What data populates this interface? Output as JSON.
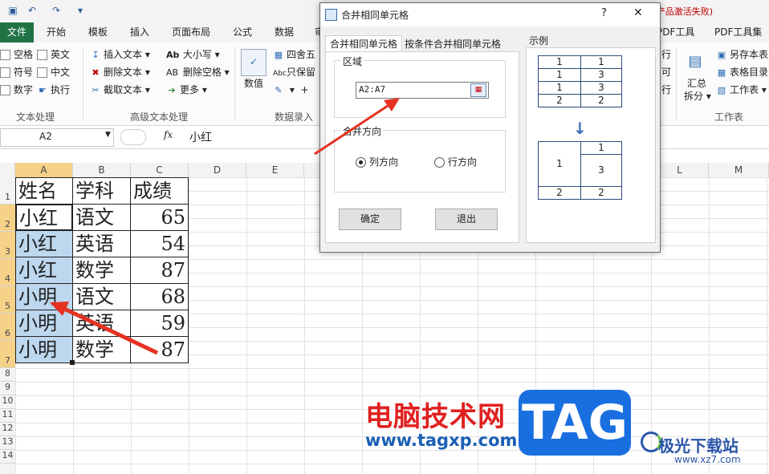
{
  "window": {
    "activation_text": "产品激活失败)"
  },
  "ribbon_tabs": [
    "文件",
    "开始",
    "模板",
    "插入",
    "页面布局",
    "公式",
    "数据",
    "审",
    "PDF工具",
    "PDF工具集"
  ],
  "ribbon": {
    "checkboxes": [
      "空格",
      "英文",
      "符号",
      "中文",
      "数字",
      "执行"
    ],
    "group1": "文本处理",
    "insert_text": "插入文本",
    "delete_text": "删除文本",
    "extract_text": "截取文本",
    "case": "大小写",
    "delete_space": "删除空格",
    "more": "更多",
    "group2": "高级文本处理",
    "number": "数值",
    "round": "四舍五",
    "keep": "只保留",
    "group3": "数据录入",
    "summary_split_1": "汇总",
    "summary_split_2": "拆分",
    "save_book": "另存本表",
    "sheet_dir": "表格目录",
    "worksheet": "工作表",
    "group4": "工作表",
    "partial_right_1": "行",
    "partial_right_2": "可",
    "partial_right_3": "行"
  },
  "formula_bar": {
    "namebox": "A2",
    "fx": "fx",
    "content": "小红"
  },
  "columns": [
    "A",
    "B",
    "C",
    "D",
    "E",
    "F",
    "G",
    "H",
    "I",
    "J",
    "K",
    "L",
    "M"
  ],
  "rows": [
    "1",
    "2",
    "3",
    "4",
    "5",
    "6",
    "7",
    "8",
    "9",
    "10",
    "11",
    "12",
    "13",
    "14"
  ],
  "table": {
    "header": [
      "姓名",
      "学科",
      "成绩"
    ],
    "rows": [
      [
        "小红",
        "语文",
        "65"
      ],
      [
        "小红",
        "英语",
        "54"
      ],
      [
        "小红",
        "数学",
        "87"
      ],
      [
        "小明",
        "语文",
        "68"
      ],
      [
        "小明",
        "英语",
        "59"
      ],
      [
        "小明",
        "数学",
        "87"
      ]
    ]
  },
  "dialog": {
    "title": "合并相同单元格",
    "help": "?",
    "close": "✕",
    "tabs": [
      "合并相同单元格",
      "按条件合并相同单元格"
    ],
    "region_label": "区域",
    "region_value": "A2:A7",
    "direction_label": "合并方向",
    "radio_column": "列方向",
    "radio_row": "行方向",
    "ok": "确定",
    "exit": "退出",
    "example_label": "示例",
    "example_top": [
      [
        "1",
        "1"
      ],
      [
        "1",
        "3"
      ],
      [
        "1",
        "3"
      ],
      [
        "2",
        "2"
      ]
    ],
    "example_bottom": {
      "merged": "1",
      "right_top": "1",
      "right_merged": "3",
      "bottom_left": "2",
      "bottom_right": "2"
    },
    "arrow": "↓"
  },
  "watermark": {
    "site_cn": "电脑技术网",
    "site_url": "www.tagxp.com",
    "logo": "TAG",
    "brand2": "极光下载站",
    "brand2_url": "www.xz7.com"
  }
}
